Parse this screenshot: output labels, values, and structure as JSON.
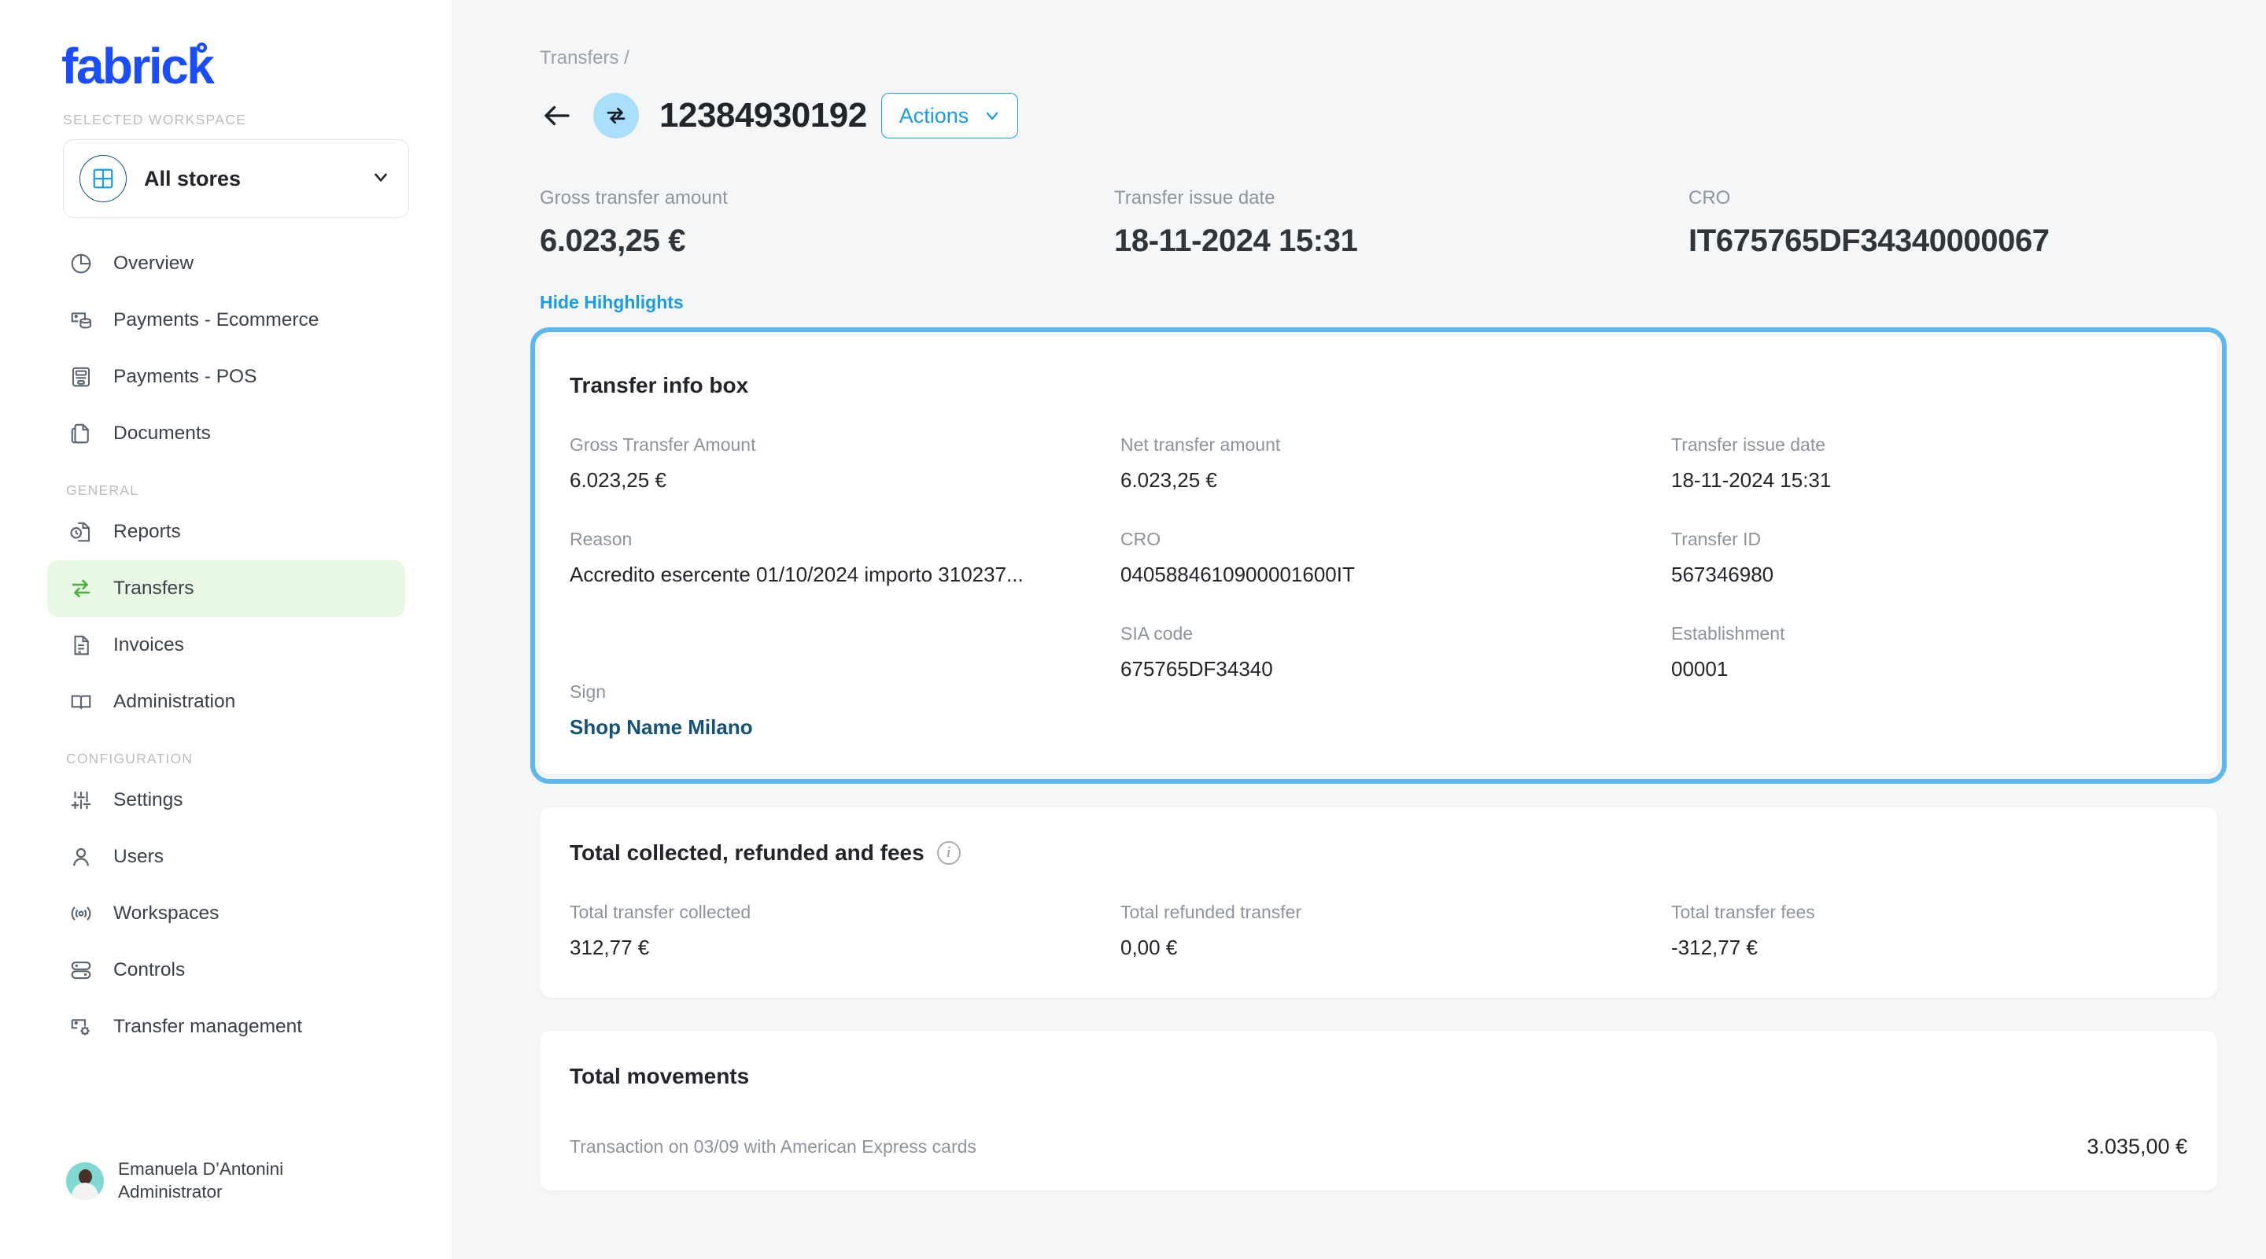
{
  "sidebar": {
    "brand": "fabrick",
    "workspace_label": "SELECTED WORKSPACE",
    "workspace_value": "All stores",
    "nav_primary": [
      {
        "label": "Overview",
        "icon": "pie-chart-icon"
      },
      {
        "label": "Payments - Ecommerce",
        "icon": "ecommerce-payments-icon"
      },
      {
        "label": "Payments - POS",
        "icon": "pos-terminal-icon"
      },
      {
        "label": "Documents",
        "icon": "documents-icon"
      }
    ],
    "section_general": "GENERAL",
    "nav_general": [
      {
        "label": "Reports",
        "icon": "reports-clock-icon"
      },
      {
        "label": "Transfers",
        "icon": "transfers-arrows-icon"
      },
      {
        "label": "Invoices",
        "icon": "invoices-icon"
      },
      {
        "label": "Administration",
        "icon": "administration-book-icon"
      }
    ],
    "section_configuration": "CONFIGURATION",
    "nav_configuration": [
      {
        "label": "Settings",
        "icon": "sliders-icon"
      },
      {
        "label": "Users",
        "icon": "user-icon"
      },
      {
        "label": "Workspaces",
        "icon": "workspaces-radar-icon"
      },
      {
        "label": "Controls",
        "icon": "controls-toggles-icon"
      },
      {
        "label": "Transfer management",
        "icon": "transfer-management-gear-icon"
      }
    ],
    "active_item": "Transfers",
    "user": {
      "name": "Emanuela D’Antonini",
      "role": "Administrator"
    }
  },
  "header": {
    "breadcrumb": "Transfers /",
    "transfer_id": "12384930192",
    "actions_label": "Actions"
  },
  "highlights": {
    "items": [
      {
        "label": "Gross transfer amount",
        "value": "6.023,25 €"
      },
      {
        "label": "Transfer issue date",
        "value": "18-11-2024 15:31"
      },
      {
        "label": "CRO",
        "value": "IT675765DF34340000067"
      }
    ],
    "toggle_label": "Hide Hihghlights"
  },
  "transfer_info_box": {
    "title": "Transfer info box",
    "col1": [
      {
        "label": "Gross Transfer Amount",
        "value": "6.023,25 €"
      },
      {
        "label": "Reason",
        "value": "Accredito esercente 01/10/2024 importo 310237..."
      },
      {
        "label": "Sign",
        "value": "Shop Name Milano"
      }
    ],
    "col2": [
      {
        "label": "Net transfer amount",
        "value": "6.023,25 €"
      },
      {
        "label": "CRO",
        "value": "0405884610900001600IT"
      },
      {
        "label": "SIA code",
        "value": "675765DF34340"
      }
    ],
    "col3": [
      {
        "label": "Transfer issue date",
        "value": "18-11-2024 15:31"
      },
      {
        "label": "Transfer ID",
        "value": "567346980"
      },
      {
        "label": "Establishment",
        "value": "00001"
      }
    ]
  },
  "totals_card": {
    "title": "Total collected, refunded and fees",
    "items": [
      {
        "label": "Total transfer collected",
        "value": "312,77 €"
      },
      {
        "label": "Total refunded transfer",
        "value": "0,00 €"
      },
      {
        "label": "Total transfer fees",
        "value": "-312,77 €"
      }
    ]
  },
  "movements_card": {
    "title": "Total movements",
    "rows": [
      {
        "description": "Transaction on 03/09 with American Express cards",
        "amount": "3.035,00 €"
      }
    ]
  },
  "colors": {
    "brand_blue": "#1a4dff",
    "accent_blue": "#1b9cea",
    "focus_outline": "#5cb8ef",
    "active_nav_bg": "#e9f8e5",
    "active_nav_icon": "#4caf3e",
    "link_navy": "#15527a",
    "badge_bg": "#a9dffa",
    "muted_text": "#8d949b"
  }
}
